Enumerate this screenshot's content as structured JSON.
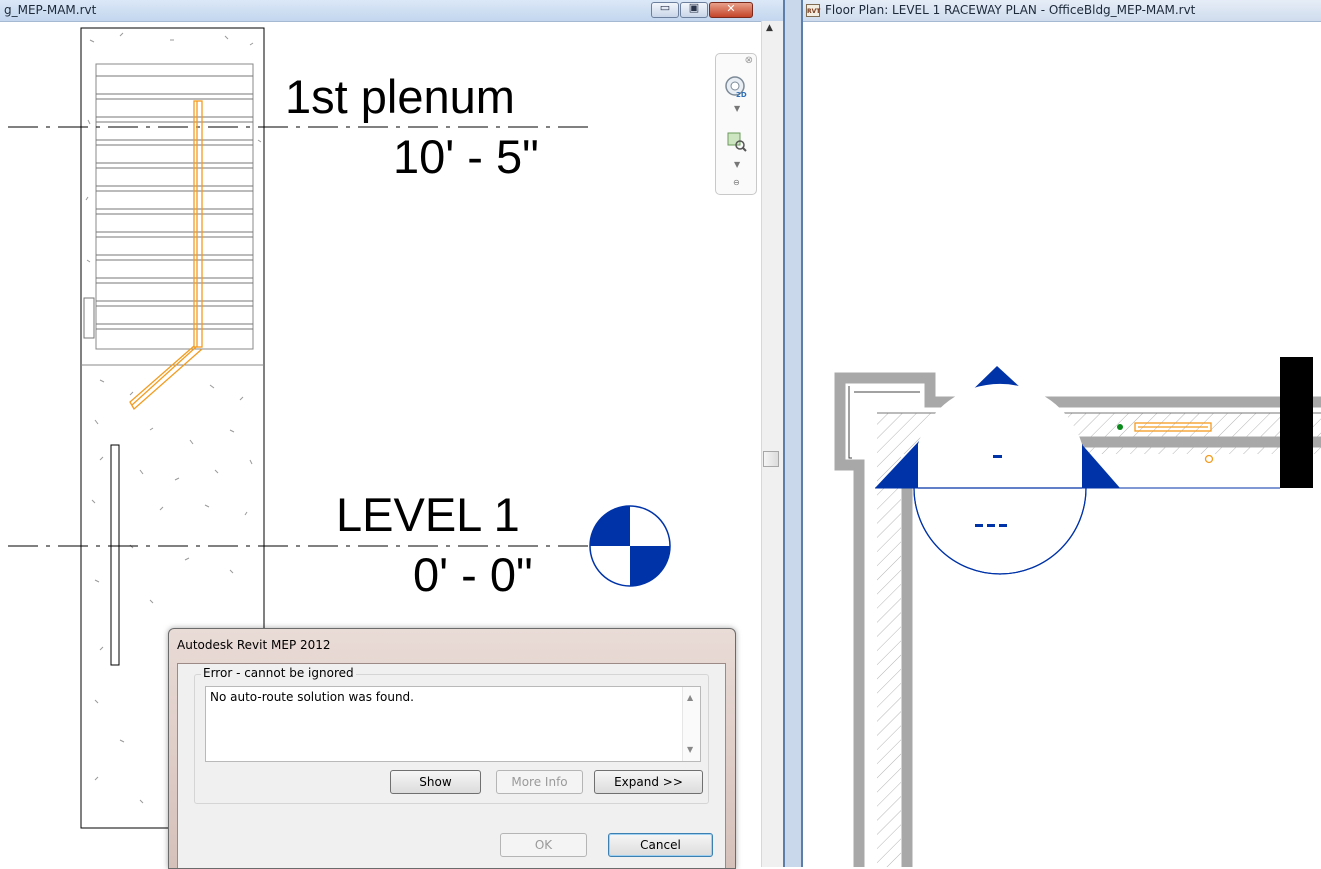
{
  "left_window": {
    "title": "g_MEP-MAM.rvt",
    "buttons": {
      "minimize": "▭",
      "restore": "▣",
      "close": "✕"
    },
    "levels": [
      {
        "name": "1st plenum",
        "elevation": "10' - 5\""
      },
      {
        "name": "LEVEL 1",
        "elevation": "0' - 0\""
      }
    ],
    "navigation_bar": {
      "wheel_label": "2D",
      "icons": [
        "steering-wheel-icon",
        "zoom-region-icon"
      ]
    }
  },
  "right_window": {
    "icon_label": "RVT",
    "title": "Floor Plan: LEVEL 1 RACEWAY PLAN - OfficeBldg_MEP-MAM.rvt"
  },
  "dialog": {
    "title": "Autodesk Revit MEP 2012",
    "group_label": "Error - cannot be ignored",
    "message": "No auto-route solution was found.",
    "buttons": {
      "show": "Show",
      "more_info": "More Info",
      "expand": "Expand >>",
      "ok": "OK",
      "cancel": "Cancel"
    }
  },
  "colors": {
    "cable_tray": "#f39c1f",
    "elevation_marker": "#0033a8",
    "wall_gray": "#a8a8a8",
    "title_bar": "#c3d6ee"
  }
}
